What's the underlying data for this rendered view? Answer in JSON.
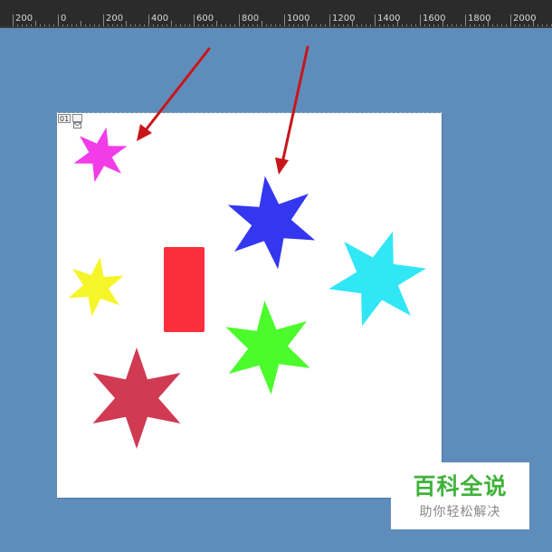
{
  "ruler": {
    "labels": [
      "200",
      "0",
      "200",
      "400",
      "600",
      "800",
      "1000",
      "1200",
      "1400",
      "1600",
      "1800",
      "2000"
    ]
  },
  "artboard": {
    "number": "01"
  },
  "shapes": {
    "colors": {
      "magenta_star": "#f23ce8",
      "blue_star": "#3437f0",
      "cyan_star": "#31e6f5",
      "yellow_star": "#f5f52a",
      "green_star": "#4cfb2c",
      "crimson_star": "#d03a52",
      "red_rectangle": "#fb2e3e",
      "arrow": "#c8161b"
    }
  },
  "watermark": {
    "title": "百科全说",
    "subtitle": "助你轻松解决"
  }
}
